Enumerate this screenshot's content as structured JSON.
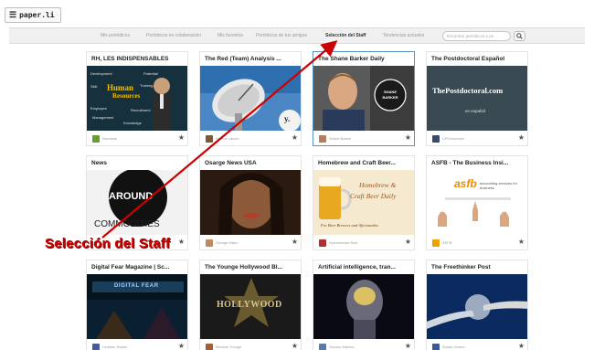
{
  "app": {
    "logo_text": "paper.li",
    "menu_icon": "hamburger-icon"
  },
  "nav": {
    "items": [
      {
        "label": "Mis periódicos",
        "active": false
      },
      {
        "label": "Periódicos en colaboración",
        "active": false
      },
      {
        "label": "Mis favoritos",
        "active": false
      },
      {
        "label": "Periódicos de tus amigos",
        "active": false
      },
      {
        "label": "Selección del Staff",
        "active": true
      },
      {
        "label": "Tendencias actuales",
        "active": false
      }
    ],
    "search_placeholder": "Encontrar periódicos o pe",
    "search_icon": "magnifier-icon"
  },
  "cards": [
    {
      "title": "RH, LES INDISPENSABLES",
      "author": "Humanis",
      "highlight": false
    },
    {
      "title": "The Red (Team) Analysis ...",
      "author": "Helene Lavoix",
      "highlight": false
    },
    {
      "title": "The Shane Barker Daily",
      "author": "Shane Barker",
      "highlight": true
    },
    {
      "title": "The Postdoctoral Español",
      "author": "CPGenomics",
      "highlight": false
    },
    {
      "title": "News",
      "author": "",
      "highlight": false
    },
    {
      "title": "Osarge News USA",
      "author": "George Mann",
      "highlight": false
    },
    {
      "title": "Homebrew and Craft Beer...",
      "author": "Homebrewer Bob",
      "highlight": false
    },
    {
      "title": "ASFB - The Business Insi...",
      "author": "ASFB",
      "highlight": false
    },
    {
      "title": "Digital Fear Magazine | Sc...",
      "author": "Graham Staker",
      "highlight": false
    },
    {
      "title": "The Younge Hollywood Bl...",
      "author": "Melanie Younge",
      "highlight": false
    },
    {
      "title": "Artificial intelligence, tran...",
      "author": "Gordon Malone",
      "highlight": false
    },
    {
      "title": "The Freethinker Post",
      "author": "Susan Gerber",
      "highlight": false
    }
  ],
  "image_text": {
    "hr_main": "Human",
    "hr_sub": "Resources",
    "hr_words": [
      "Development",
      "Potential",
      "Skill",
      "Training",
      "Employee",
      "Recruitment"
    ],
    "hr_words_b": [
      "Management",
      "Knowledge"
    ],
    "redteam_badge": "y.",
    "shane_badge": "SHANE BARKER",
    "postdoc_title": "ThePostdoctoral.com",
    "postdoc_sub": "en español",
    "news_around": "AROUND",
    "news_commodities": "COMMODITIES",
    "beer_line1": "Homebrew &",
    "beer_line2": "Craft Beer Daily",
    "beer_line3": "For Beer Brewers and Aficionados",
    "asfb_logo": "asfb",
    "asfb_sub": "accounting services for business",
    "digital_banner": "DIGITAL FEAR",
    "hollywood_word": "HOLLYWOOD"
  },
  "annotation": {
    "label": "Selección del Staff",
    "color": "#cc0000"
  },
  "colors": {
    "nav_bg": "#f0f0f0",
    "highlight_border": "#5b8fbf",
    "annotation": "#cc0000"
  }
}
